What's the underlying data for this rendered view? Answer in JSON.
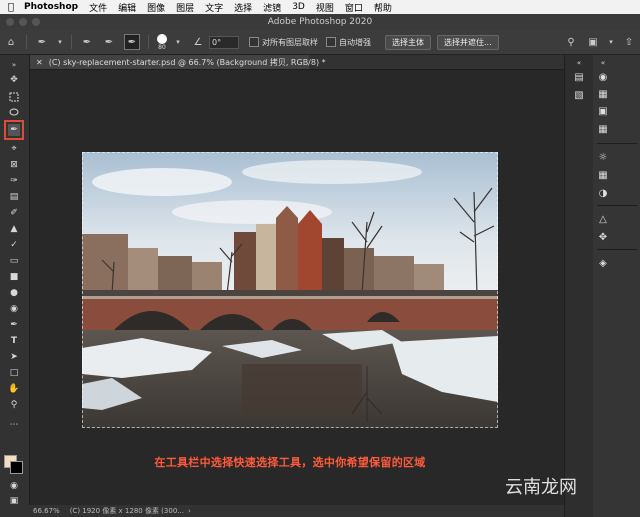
{
  "menubar": {
    "app": "Photoshop",
    "items": [
      "文件",
      "编辑",
      "图像",
      "图层",
      "文字",
      "选择",
      "滤镜",
      "3D",
      "视图",
      "窗口",
      "帮助"
    ]
  },
  "window": {
    "title": "Adobe Photoshop 2020"
  },
  "options": {
    "brush_size": "80",
    "angle": "0°",
    "sample_all_layers": "对所有图层取样",
    "auto_enhance": "自动增强",
    "select_subject": "选择主体",
    "select_and_mask": "选择并遮住..."
  },
  "document": {
    "tab_title": "(C) sky-replacement-starter.psd @ 66.7% (Background 拷贝, RGB/8) *"
  },
  "caption": "在工具栏中选择快速选择工具，选中你希望保留的区域",
  "status": {
    "zoom": "66.67%",
    "info": "(C) 1920 像素 x 1280 像素 (300..."
  },
  "watermark": "云南龙网",
  "colors": {
    "foreground": "#f3dcc1",
    "background": "#000000",
    "highlight": "#e04a3a"
  }
}
